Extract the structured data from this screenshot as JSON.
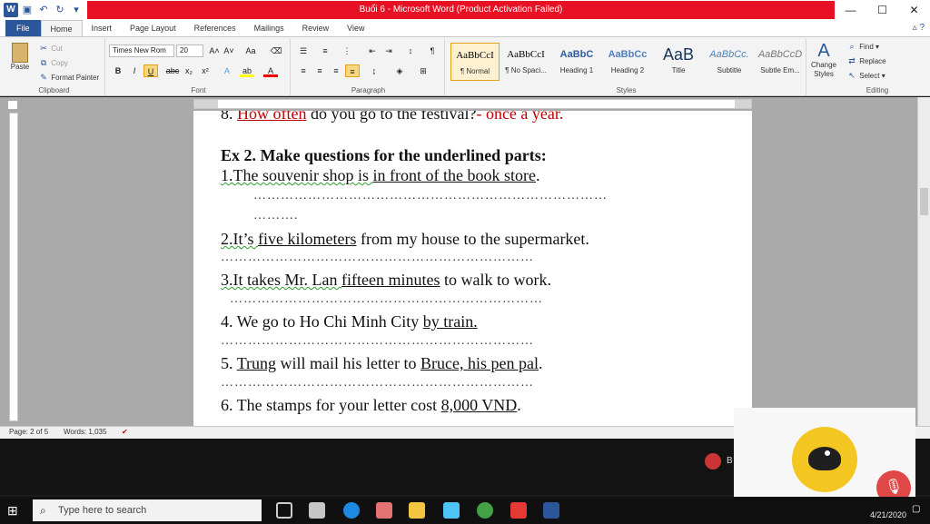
{
  "window": {
    "title": "Buổi 6 - Microsoft Word (Product Activation Failed)",
    "qat_icons": [
      "word-icon",
      "save-icon",
      "undo-icon",
      "redo-icon"
    ]
  },
  "tabs": [
    "File",
    "Home",
    "Insert",
    "Page Layout",
    "References",
    "Mailings",
    "Review",
    "View"
  ],
  "ribbon": {
    "clipboard": {
      "label": "Clipboard",
      "paste": "Paste",
      "cut": "Cut",
      "copy": "Copy",
      "format_painter": "Format Painter"
    },
    "font": {
      "label": "Font",
      "font_name": "Times New Rom",
      "font_size": "20"
    },
    "paragraph": {
      "label": "Paragraph"
    },
    "styles": {
      "label": "Styles",
      "items": [
        {
          "sample": "AaBbCcI",
          "name": "¶ Normal"
        },
        {
          "sample": "AaBbCcI",
          "name": "¶ No Spaci..."
        },
        {
          "sample": "AaBbC",
          "name": "Heading 1"
        },
        {
          "sample": "AaBbCc",
          "name": "Heading 2"
        },
        {
          "sample": "AaB",
          "name": "Title"
        },
        {
          "sample": "AaBbCc.",
          "name": "Subtitle"
        },
        {
          "sample": "AaBbCcD",
          "name": "Subtle Em..."
        }
      ],
      "change_styles": "Change Styles"
    },
    "editing": {
      "label": "Editing",
      "find": "Find",
      "replace": "Replace",
      "select": "Select"
    }
  },
  "document": {
    "top_partial": {
      "num": "8.",
      "q": "How often",
      "rest": " do you go to the festival?",
      "ans": "- once a year."
    },
    "heading": "Ex 2.   Make questions for the underlined parts:",
    "items": [
      {
        "pre": "1.The souvenir shop is ",
        "u": "in front of the book store",
        "post": "."
      },
      {
        "pre": "2.It’s ",
        "u": "five  kilometers",
        "post": " from my house to the supermarket."
      },
      {
        "pre": "3.It takes Mr. Lan ",
        "u": "fifteen minutes",
        "post": " to walk to work."
      },
      {
        "pre": "4. We go to Ho Chi Minh City ",
        "u": "by train.",
        "post": ""
      },
      {
        "pre": "5. ",
        "u": "Trung",
        "mid": " will mail his letter to ",
        "u2": "Bruce, his pen pal",
        "post": "."
      },
      {
        "pre": "6. The stamps for your letter cost ",
        "u": "8,000 VND",
        "post": "."
      }
    ],
    "dots_long": "……………………………………………………………………",
    "dots_short": "……….",
    "dots_mid": "……………………………………………………………"
  },
  "statusbar": {
    "page": "Page: 2 of 5",
    "words": "Words: 1,035"
  },
  "meeting": {
    "rec_label": "B"
  },
  "taskbar": {
    "search_placeholder": "Type here to search",
    "date": "4/21/2020"
  },
  "colors": {
    "accent": "#2b579a",
    "title_alert": "#e81123",
    "answer_red": "#c00000"
  }
}
